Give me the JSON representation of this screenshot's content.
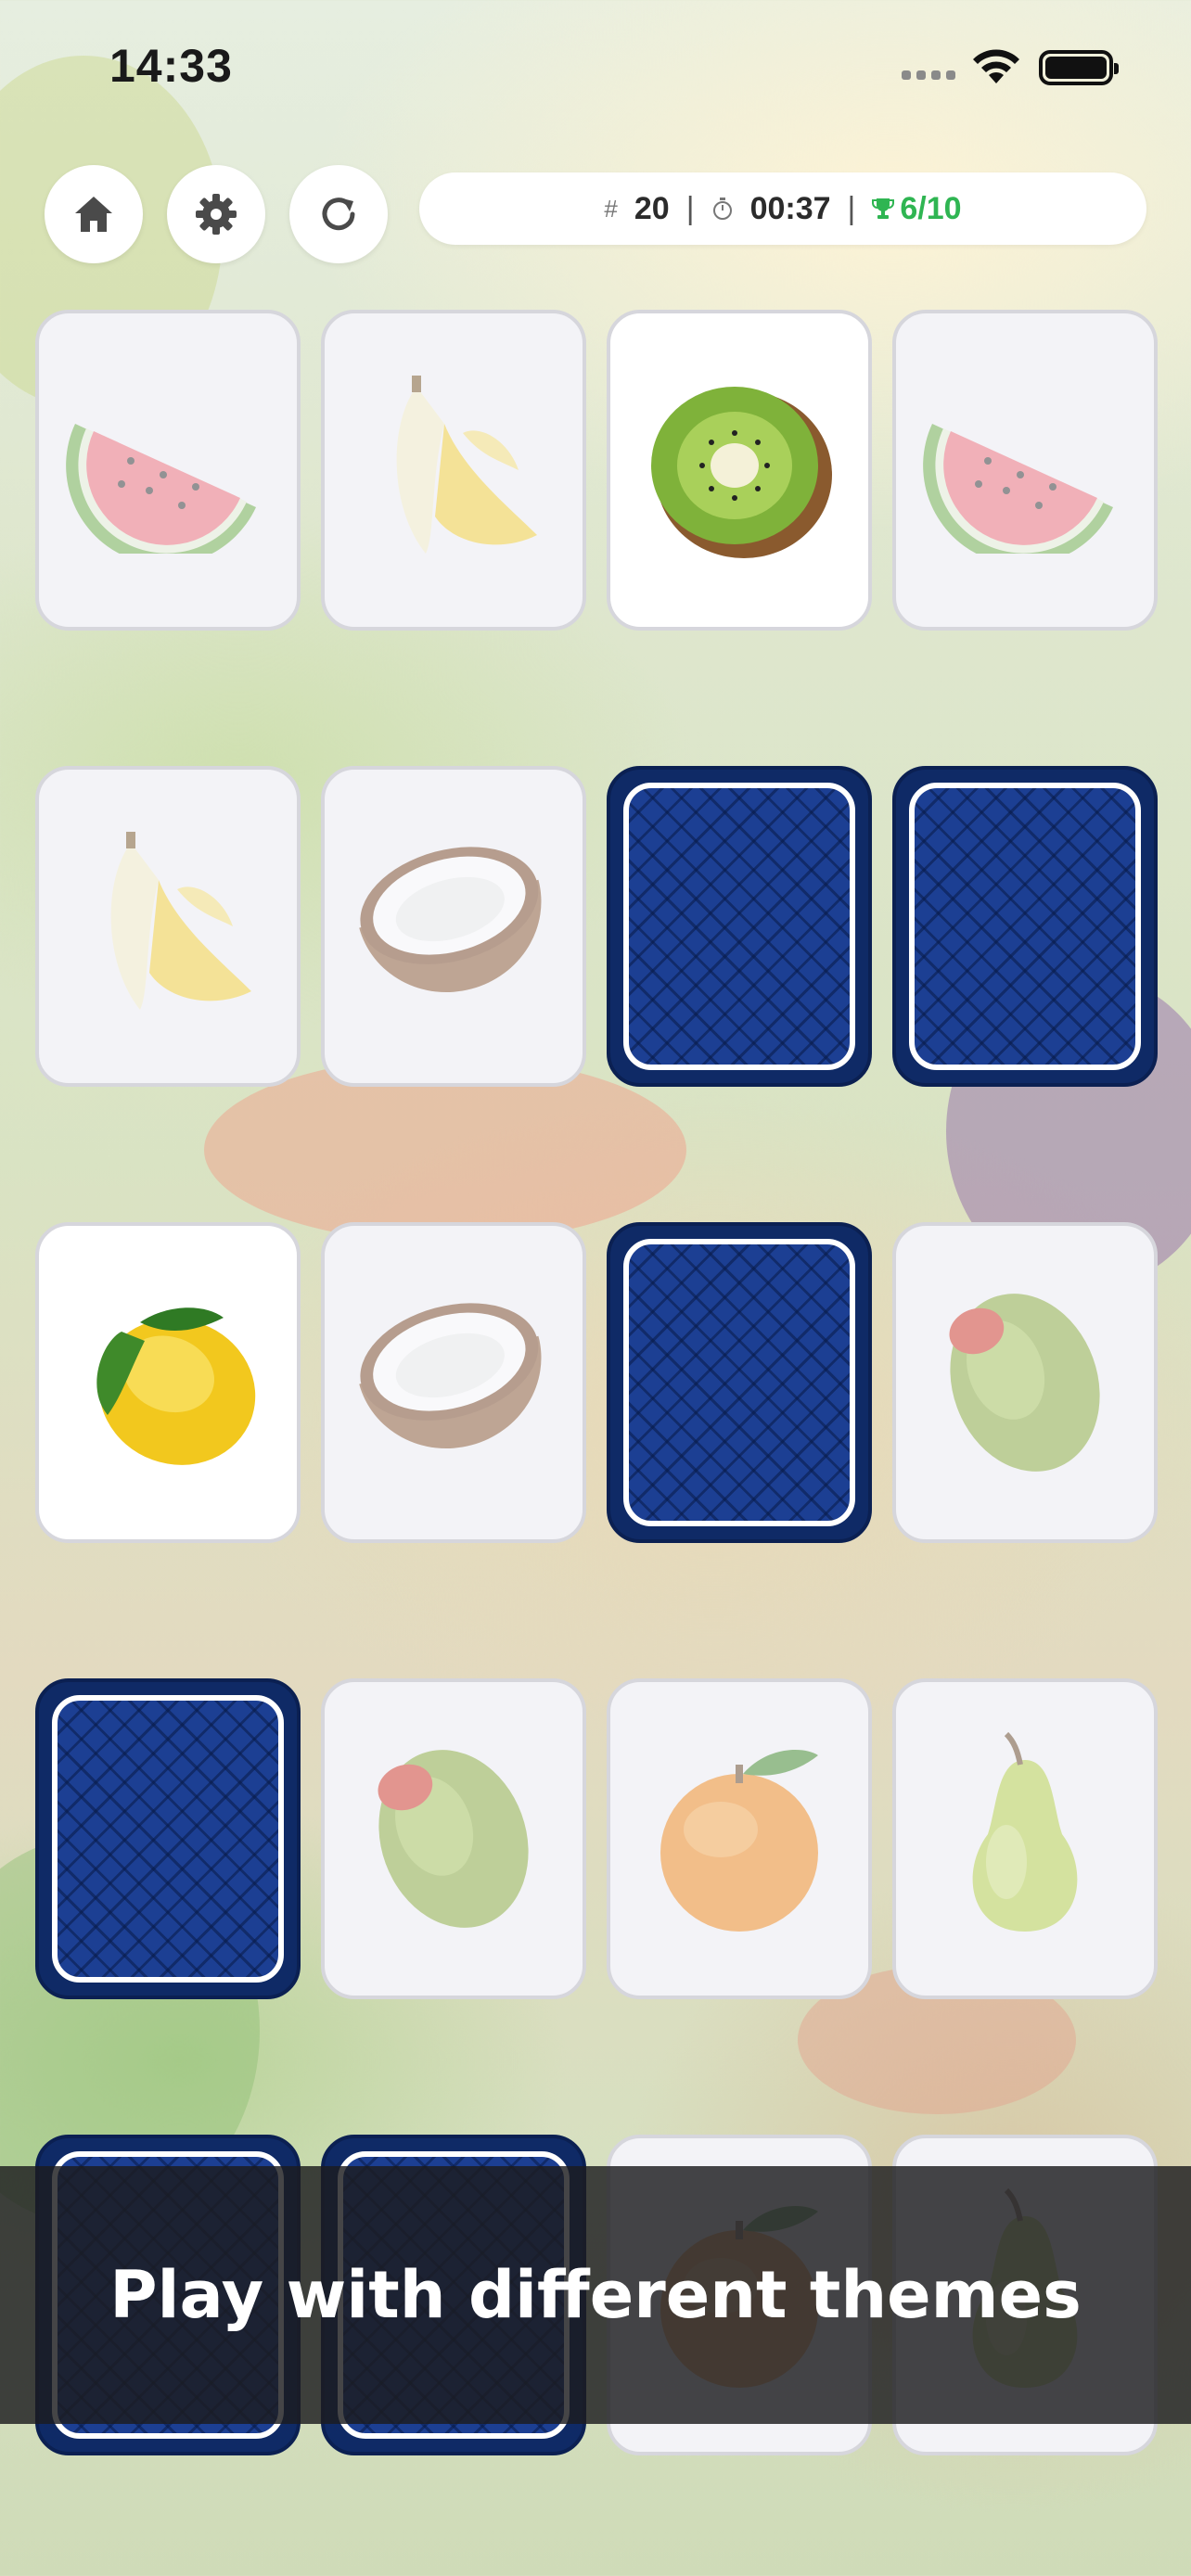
{
  "status_bar": {
    "time": "14:33"
  },
  "toolbar": {
    "home_icon": "home-icon",
    "settings_icon": "gear-icon",
    "restart_icon": "restart-icon"
  },
  "stats": {
    "moves": "20",
    "timer": "00:37",
    "pairs": "6/10",
    "moves_icon": "hash-icon",
    "timer_icon": "stopwatch-icon",
    "pairs_icon": "trophy-icon",
    "pairs_color": "#2fb552"
  },
  "board": {
    "card_back_color": "#1c3f93",
    "rows": [
      [
        "watermelon",
        "banana",
        "kiwi",
        "watermelon"
      ],
      [
        "banana",
        "coconut",
        "hidden",
        "hidden"
      ],
      [
        "lemon",
        "coconut",
        "hidden",
        "olive"
      ],
      [
        "hidden",
        "olive",
        "orange",
        "pear"
      ],
      [
        "hidden",
        "hidden",
        "orange",
        "pear"
      ]
    ]
  },
  "banner": {
    "text": "Play with different themes"
  }
}
